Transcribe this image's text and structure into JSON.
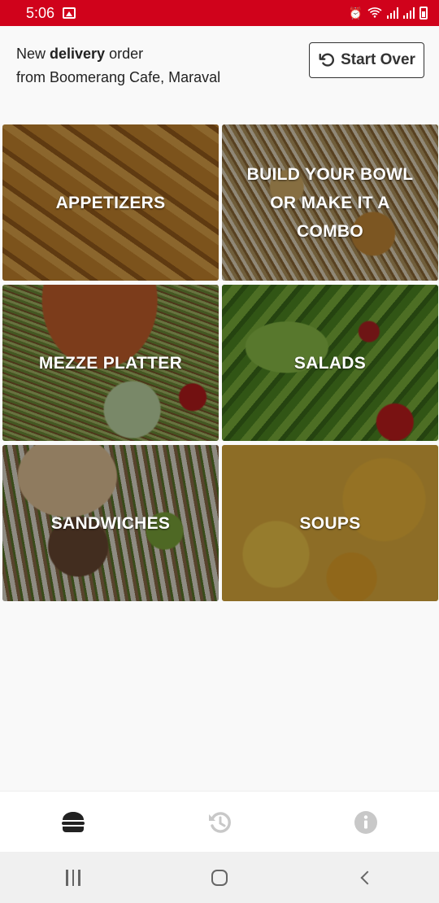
{
  "status_bar": {
    "time": "5:06"
  },
  "header": {
    "line1_prefix": "New ",
    "line1_bold": "delivery",
    "line1_suffix": " order",
    "line2": "from Boomerang Cafe, Maraval",
    "start_over_label": "Start Over"
  },
  "categories": [
    {
      "label": "APPETIZERS"
    },
    {
      "label": "BUILD YOUR BOWL OR MAKE IT A COMBO"
    },
    {
      "label": "MEZZE PLATTER"
    },
    {
      "label": "SALADS"
    },
    {
      "label": "SANDWICHES"
    },
    {
      "label": "SOUPS"
    }
  ],
  "bottom_nav": {
    "items": [
      {
        "icon": "burger-icon",
        "active": true
      },
      {
        "icon": "history-icon",
        "active": false
      },
      {
        "icon": "info-icon",
        "active": false
      }
    ],
    "active_color": "#222222",
    "inactive_color": "#c8c8c8"
  },
  "theme": {
    "status_bar_color": "#d0021b"
  }
}
